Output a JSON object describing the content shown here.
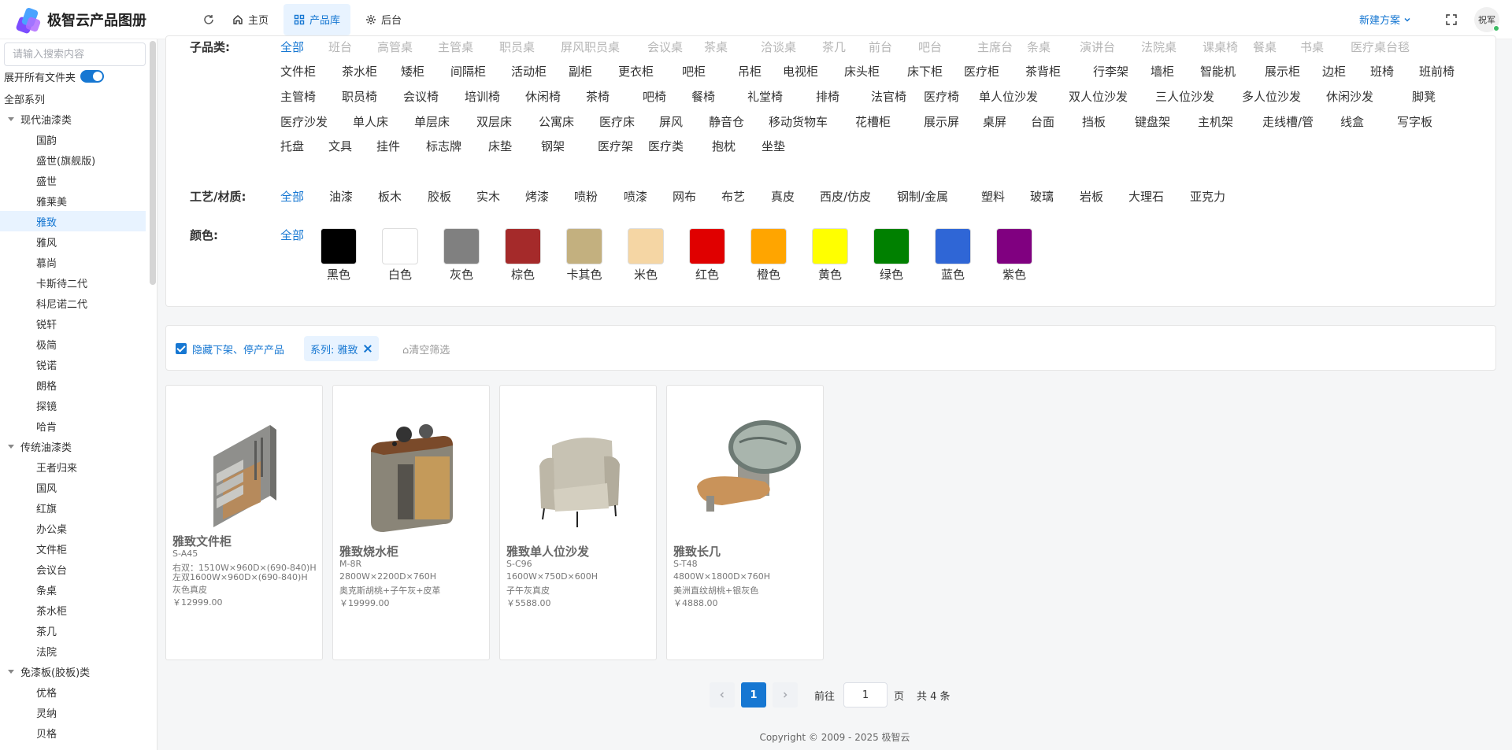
{
  "header": {
    "logo_text": "极智云产品图册",
    "nav": [
      {
        "label": "主页",
        "icon": "home-icon",
        "active": false
      },
      {
        "label": "产品库",
        "icon": "grid-icon",
        "active": true
      },
      {
        "label": "后台",
        "icon": "gear-icon",
        "active": false
      }
    ],
    "new_plan": "新建方案",
    "user": "祝军"
  },
  "sidebar": {
    "search_placeholder": "请输入搜索内容",
    "expand_all_label": "展开所有文件夹",
    "expand_all_on": true,
    "root": "全部系列",
    "groups": [
      {
        "label": "现代油漆类",
        "items": [
          "国韵",
          "盛世(旗舰版)",
          "盛世",
          "雅莱美",
          "雅致",
          "雅风",
          "慕尚",
          "卡斯待二代",
          "科尼诺二代",
          "锐轩",
          "极简",
          "锐诺",
          "朗格",
          "探镜",
          "哈肯"
        ]
      },
      {
        "label": "传统油漆类",
        "items": [
          "王者归来",
          "国风",
          "红旗",
          "办公桌",
          "文件柜",
          "会议台",
          "条桌",
          "茶水柜",
          "茶几",
          "法院"
        ]
      },
      {
        "label": "免漆板(胶板)类",
        "items": [
          "优格",
          "灵纳",
          "贝格"
        ]
      }
    ],
    "selected": "雅致"
  },
  "filters": {
    "subcategory": {
      "label": "子品类:",
      "rows": [
        [
          "全部",
          "班台",
          "高管桌",
          "主管桌",
          "职员桌",
          "屏风职员桌",
          "会议桌",
          "茶桌",
          "洽谈桌",
          "茶几",
          "前台",
          "吧台",
          "主席台",
          "条桌",
          "演讲台",
          "法院桌",
          "课桌椅",
          "餐桌",
          "书桌",
          "医疗桌台毯"
        ],
        [
          "文件柜",
          "茶水柜",
          "矮柜",
          "间隔柜",
          "活动柜",
          "副柜",
          "更衣柜",
          "吧柜",
          "吊柜",
          "电视柜",
          "床头柜",
          "床下柜",
          "医疗柜",
          "茶背柜",
          "行李架",
          "墙柜",
          "智能机",
          "展示柜",
          "边柜",
          "班椅",
          "班前椅"
        ],
        [
          "主管椅",
          "职员椅",
          "会议椅",
          "培训椅",
          "休闲椅",
          "茶椅",
          "吧椅",
          "餐椅",
          "礼堂椅",
          "排椅",
          "法官椅",
          "医疗椅",
          "单人位沙发",
          "双人位沙发",
          "三人位沙发",
          "多人位沙发",
          "休闲沙发",
          "脚凳"
        ],
        [
          "医疗沙发",
          "单人床",
          "单层床",
          "双层床",
          "公寓床",
          "医疗床",
          "屏风",
          "静音仓",
          "移动货物车",
          "花槽柜",
          "展示屏",
          "桌屏",
          "台面",
          "挡板",
          "键盘架",
          "主机架",
          "走线槽/管",
          "线盒",
          "写字板"
        ],
        [
          "托盘",
          "文具",
          "挂件",
          "标志牌",
          "床垫",
          "钢架",
          "医疗架",
          "医疗类",
          "抱枕",
          "坐垫"
        ]
      ]
    },
    "material": {
      "label": "工艺/材质:",
      "options": [
        "全部",
        "油漆",
        "板木",
        "胶板",
        "实木",
        "烤漆",
        "喷粉",
        "喷漆",
        "网布",
        "布艺",
        "真皮",
        "西皮/仿皮",
        "钢制/金属",
        "塑料",
        "玻璃",
        "岩板",
        "大理石",
        "亚克力"
      ]
    },
    "color": {
      "label": "颜色:",
      "all": "全部",
      "swatches": [
        {
          "name": "黑色",
          "hex": "#000000"
        },
        {
          "name": "白色",
          "hex": "#ffffff"
        },
        {
          "name": "灰色",
          "hex": "#808080"
        },
        {
          "name": "棕色",
          "hex": "#a52a2a"
        },
        {
          "name": "卡其色",
          "hex": "#c3b07f"
        },
        {
          "name": "米色",
          "hex": "#f5d6a4"
        },
        {
          "name": "红色",
          "hex": "#e00000"
        },
        {
          "name": "橙色",
          "hex": "#ffa500"
        },
        {
          "name": "黄色",
          "hex": "#ffff00"
        },
        {
          "name": "绿色",
          "hex": "#008000"
        },
        {
          "name": "蓝色",
          "hex": "#2f66d6"
        },
        {
          "name": "紫色",
          "hex": "#800080"
        }
      ]
    }
  },
  "active_filters": {
    "hide_discontinued_checked": true,
    "hide_discontinued_label": "隐藏下架、停产产品",
    "tag": "系列: 雅致",
    "clear_label": "清空筛选"
  },
  "products": [
    {
      "name": "雅致文件柜",
      "code": "S-A45",
      "size_lines": [
        "右双：1510W×960D×(690-840)H",
        "左双1600W×960D×(690-840)H"
      ],
      "finish": "灰色真皮",
      "price": "￥12999.00",
      "image": "file-cabinet-image"
    },
    {
      "name": "雅致烧水柜",
      "code": "M-8R",
      "size_lines": [
        "2800W×2200D×760H"
      ],
      "finish": "奥克斯胡桃+子午灰+皮革",
      "price": "￥19999.00",
      "image": "tea-cabinet-image"
    },
    {
      "name": "雅致单人位沙发",
      "code": "S-C96",
      "size_lines": [
        "1600W×750D×600H"
      ],
      "finish": "子午灰真皮",
      "price": "￥5588.00",
      "image": "armchair-image"
    },
    {
      "name": "雅致长几",
      "code": "S-T48",
      "size_lines": [
        "4800W×1800D×760H"
      ],
      "finish": "美洲直纹胡桃+银灰色",
      "price": "￥4888.00",
      "image": "coffee-table-image"
    }
  ],
  "pagination": {
    "current_page": "1",
    "goto_label": "前往",
    "goto_value": "1",
    "page_unit": "页",
    "total": "共 4 条"
  },
  "footer": "Copyright © 2009 - 2025 极智云",
  "colors": {
    "accent": "#1677d2",
    "accent_bg": "#e8f3ff"
  }
}
